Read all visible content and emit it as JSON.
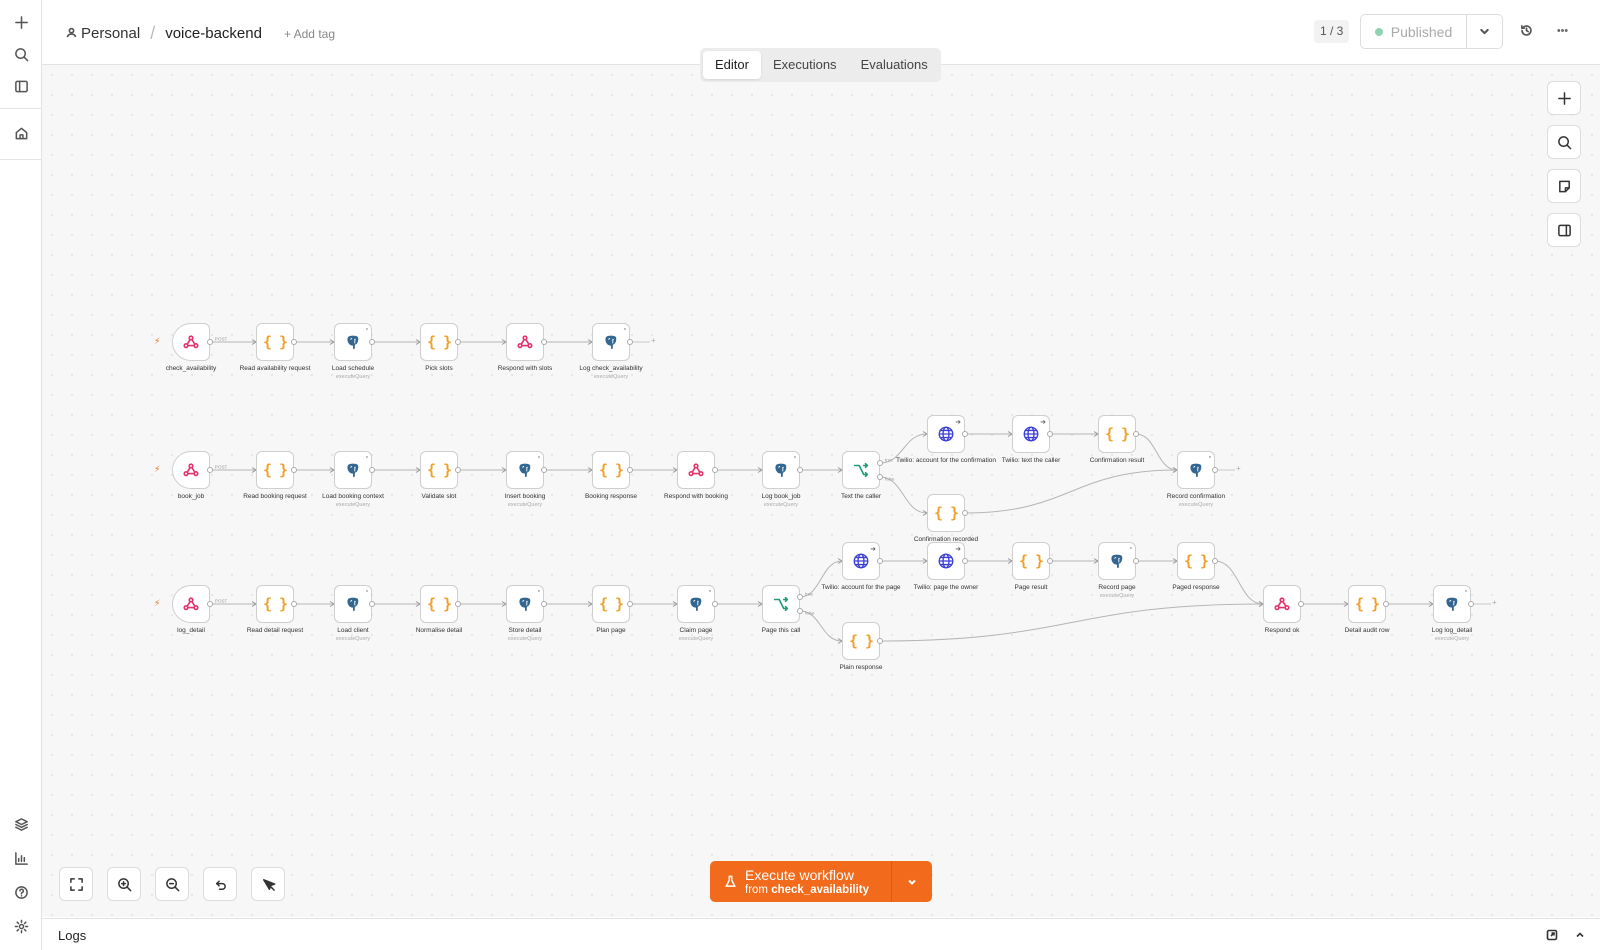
{
  "sidebar": {
    "top_icons": [
      "plus-icon",
      "search-icon",
      "panel-left-icon",
      "home-icon"
    ],
    "bottom_icons": [
      "templates-icon",
      "insights-icon",
      "help-icon",
      "settings-icon"
    ]
  },
  "header": {
    "project": "Personal",
    "workflow_name": "voice-backend",
    "add_tag": "+ Add tag",
    "version_counter": "1 / 3",
    "publish_label": "Published",
    "status_color": "#8fd3b3"
  },
  "tabs": [
    {
      "label": "Editor",
      "active": true
    },
    {
      "label": "Executions",
      "active": false
    },
    {
      "label": "Evaluations",
      "active": false
    }
  ],
  "workflow": {
    "nodes": [
      {
        "id": "n1",
        "label": "check_availability",
        "type": "webhook",
        "trigger": true
      },
      {
        "id": "n2",
        "label": "Read availability request",
        "type": "code"
      },
      {
        "id": "n3",
        "label": "Load schedule",
        "sub": "executeQuery",
        "type": "postgres"
      },
      {
        "id": "n4",
        "label": "Pick slots",
        "type": "code"
      },
      {
        "id": "n5",
        "label": "Respond with slots",
        "type": "webhook"
      },
      {
        "id": "n6",
        "label": "Log check_availability",
        "sub": "executeQuery",
        "type": "postgres"
      },
      {
        "id": "b1",
        "label": "book_job",
        "type": "webhook",
        "trigger": true
      },
      {
        "id": "b2",
        "label": "Read booking request",
        "type": "code"
      },
      {
        "id": "b3",
        "label": "Load booking context",
        "sub": "executeQuery",
        "type": "postgres"
      },
      {
        "id": "b4",
        "label": "Validate slot",
        "type": "code"
      },
      {
        "id": "b5",
        "label": "Insert booking",
        "sub": "executeQuery",
        "type": "postgres"
      },
      {
        "id": "b6",
        "label": "Booking response",
        "type": "code"
      },
      {
        "id": "b7",
        "label": "Respond with booking",
        "type": "webhook"
      },
      {
        "id": "b8",
        "label": "Log book_job",
        "sub": "executeQuery",
        "type": "postgres"
      },
      {
        "id": "b9",
        "label": "Text the caller",
        "type": "if"
      },
      {
        "id": "b10",
        "label": "Twilio: account for the confirmation",
        "type": "http"
      },
      {
        "id": "b11",
        "label": "Twilio: text the caller",
        "type": "http"
      },
      {
        "id": "b12",
        "label": "Confirmation result",
        "type": "code"
      },
      {
        "id": "b13",
        "label": "Confirmation recorded",
        "type": "code"
      },
      {
        "id": "b14",
        "label": "Record confirmation",
        "sub": "executeQuery",
        "type": "postgres"
      },
      {
        "id": "l1",
        "label": "log_detail",
        "type": "webhook",
        "trigger": true
      },
      {
        "id": "l2",
        "label": "Read detail request",
        "type": "code"
      },
      {
        "id": "l3",
        "label": "Load client",
        "sub": "executeQuery",
        "type": "postgres"
      },
      {
        "id": "l4",
        "label": "Normalise detail",
        "type": "code"
      },
      {
        "id": "l5",
        "label": "Store detail",
        "sub": "executeQuery",
        "type": "postgres"
      },
      {
        "id": "l6",
        "label": "Plan page",
        "type": "code"
      },
      {
        "id": "l7",
        "label": "Claim page",
        "sub": "executeQuery",
        "type": "postgres"
      },
      {
        "id": "l8",
        "label": "Page this call",
        "type": "if"
      },
      {
        "id": "l9",
        "label": "Twilio: account for the page",
        "type": "http"
      },
      {
        "id": "l10",
        "label": "Twilio: page the owner",
        "type": "http"
      },
      {
        "id": "l11",
        "label": "Page result",
        "type": "code"
      },
      {
        "id": "l12",
        "label": "Record page",
        "sub": "executeQuery",
        "type": "postgres"
      },
      {
        "id": "l13",
        "label": "Paged response",
        "type": "code"
      },
      {
        "id": "l14",
        "label": "Plain response",
        "type": "code"
      },
      {
        "id": "l15",
        "label": "Respond ok",
        "type": "webhook"
      },
      {
        "id": "l16",
        "label": "Detail audit row",
        "type": "code"
      },
      {
        "id": "l17",
        "label": "Log log_detail",
        "sub": "executeQuery",
        "type": "postgres"
      }
    ],
    "edges": [
      [
        "n1",
        "n2"
      ],
      [
        "n2",
        "n3"
      ],
      [
        "n3",
        "n4"
      ],
      [
        "n4",
        "n5"
      ],
      [
        "n5",
        "n6"
      ],
      [
        "b1",
        "b2"
      ],
      [
        "b2",
        "b3"
      ],
      [
        "b3",
        "b4"
      ],
      [
        "b4",
        "b5"
      ],
      [
        "b5",
        "b6"
      ],
      [
        "b6",
        "b7"
      ],
      [
        "b7",
        "b8"
      ],
      [
        "b8",
        "b9"
      ],
      [
        "b9",
        "b10",
        "true"
      ],
      [
        "b9",
        "b13",
        "false"
      ],
      [
        "b10",
        "b11"
      ],
      [
        "b11",
        "b12"
      ],
      [
        "b12",
        "b14"
      ],
      [
        "b13",
        "b14"
      ],
      [
        "l1",
        "l2"
      ],
      [
        "l2",
        "l3"
      ],
      [
        "l3",
        "l4"
      ],
      [
        "l4",
        "l5"
      ],
      [
        "l5",
        "l6"
      ],
      [
        "l6",
        "l7"
      ],
      [
        "l7",
        "l8"
      ],
      [
        "l8",
        "l9",
        "true"
      ],
      [
        "l8",
        "l14",
        "false"
      ],
      [
        "l9",
        "l10"
      ],
      [
        "l10",
        "l11"
      ],
      [
        "l11",
        "l12"
      ],
      [
        "l12",
        "l13"
      ],
      [
        "l13",
        "l15"
      ],
      [
        "l14",
        "l15"
      ],
      [
        "l15",
        "l16"
      ],
      [
        "l16",
        "l17"
      ]
    ],
    "edge_labels": {
      "post": "POST",
      "true": "true",
      "false": "false"
    },
    "tail_nodes": [
      "n6",
      "b14",
      "l17"
    ]
  },
  "canvas_tools": [
    "plus-icon",
    "search-icon",
    "sticky-note-icon",
    "panel-right-icon"
  ],
  "bottom_tools": [
    "fit-view-icon",
    "zoom-in-icon",
    "zoom-out-icon",
    "undo-icon",
    "tidy-up-icon"
  ],
  "execute": {
    "label": "Execute workflow",
    "from_prefix": "from",
    "from_node": "check_availability"
  },
  "logs": {
    "title": "Logs"
  },
  "colors": {
    "accent": "#f26a1b",
    "code": "#f0a12b",
    "webhook": "#e3336b",
    "http": "#3b3fd8",
    "postgres": "#336791",
    "if": "#1a9e7a"
  }
}
